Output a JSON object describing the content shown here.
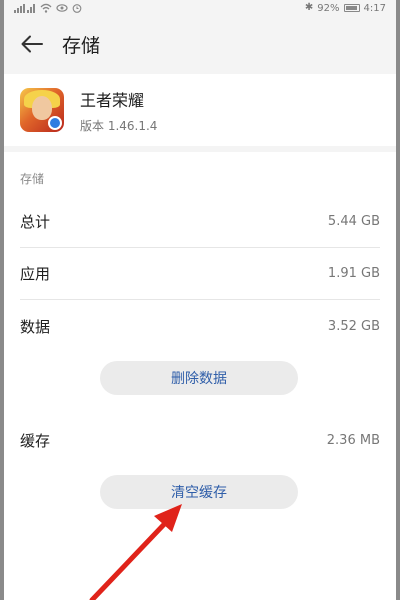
{
  "status_bar": {
    "battery_text": "92%",
    "time": "4:17"
  },
  "header": {
    "title": "存储",
    "back_icon": "arrow-left-icon"
  },
  "app": {
    "name": "王者荣耀",
    "version": "版本 1.46.1.4"
  },
  "storage": {
    "section_title": "存储",
    "rows": [
      {
        "label": "总计",
        "value": "5.44 GB"
      },
      {
        "label": "应用",
        "value": "1.91 GB"
      },
      {
        "label": "数据",
        "value": "3.52 GB"
      }
    ],
    "clear_data_label": "删除数据",
    "cache": {
      "label": "缓存",
      "value": "2.36 MB"
    },
    "clear_cache_label": "清空缓存"
  },
  "colors": {
    "accent": "#2f5ea9",
    "annotation_arrow": "#e0231a"
  }
}
